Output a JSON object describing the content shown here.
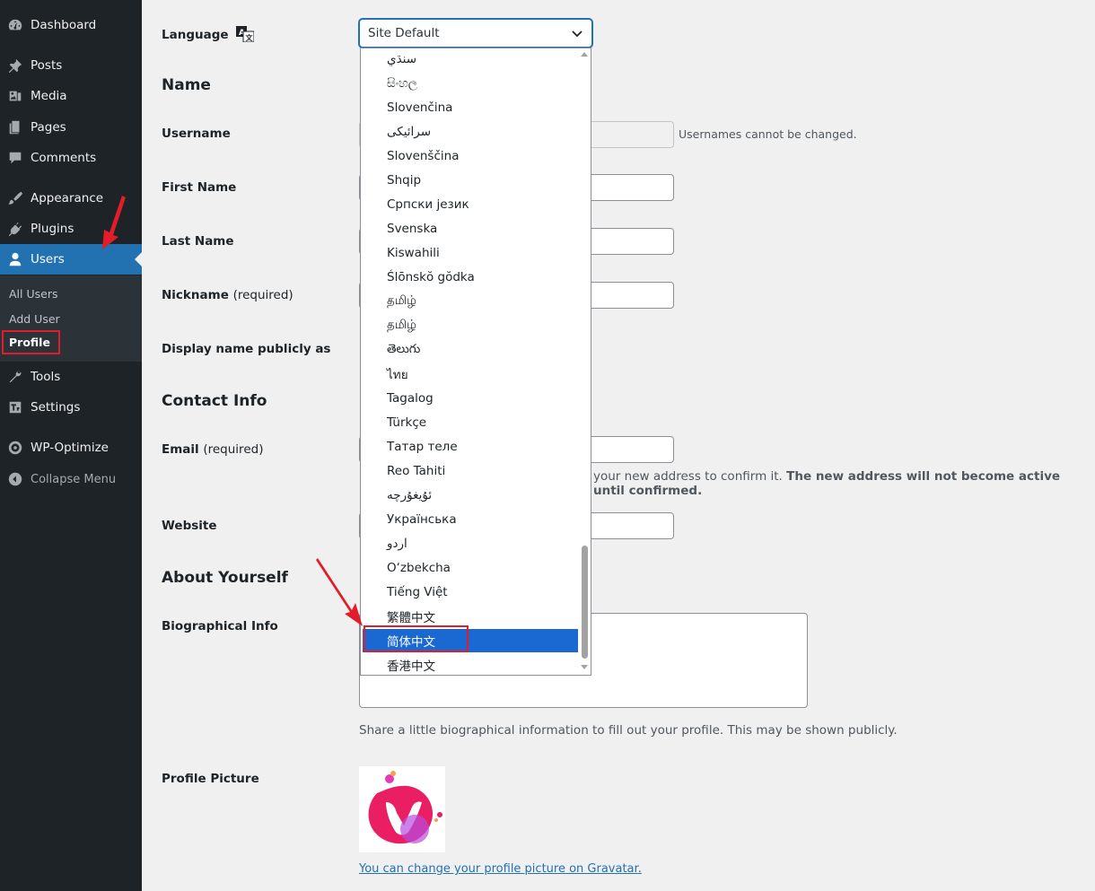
{
  "sidebar": {
    "items": [
      {
        "label": "Dashboard",
        "icon": "dashboard-icon"
      },
      {
        "label": "Posts",
        "icon": "pin-icon"
      },
      {
        "label": "Media",
        "icon": "media-icon"
      },
      {
        "label": "Pages",
        "icon": "pages-icon"
      },
      {
        "label": "Comments",
        "icon": "comment-icon"
      },
      {
        "label": "Appearance",
        "icon": "paintbrush-icon"
      },
      {
        "label": "Plugins",
        "icon": "plugin-icon"
      },
      {
        "label": "Users",
        "icon": "user-icon"
      },
      {
        "label": "Tools",
        "icon": "wrench-icon"
      },
      {
        "label": "Settings",
        "icon": "settings-icon"
      },
      {
        "label": "WP-Optimize",
        "icon": "wp-optimize-icon"
      },
      {
        "label": "Collapse Menu",
        "icon": "collapse-icon"
      }
    ],
    "submenu": [
      {
        "label": "All Users"
      },
      {
        "label": "Add User"
      },
      {
        "label": "Profile"
      }
    ],
    "colors": {
      "bg": "#1d2327",
      "current": "#2271b1",
      "submenu_bg": "#2c3338"
    }
  },
  "form": {
    "language_label": "Language",
    "language_value": "Site Default",
    "name_section": "Name",
    "username_label": "Username",
    "username_desc": "Usernames cannot be changed.",
    "first_name_label": "First Name",
    "last_name_label": "Last Name",
    "nickname_label": "Nickname",
    "required_text": "(required)",
    "display_name_label": "Display name publicly as",
    "contact_section": "Contact Info",
    "email_label": "Email",
    "email_desc_prefix": "your new address to confirm it. ",
    "email_desc_bold": "The new address will not become active until confirmed.",
    "website_label": "Website",
    "about_section": "About Yourself",
    "bio_label": "Biographical Info",
    "bio_desc": "Share a little biographical information to fill out your profile. This may be shown publicly.",
    "profile_picture_label": "Profile Picture",
    "gravatar_link": "You can change your profile picture on Gravatar",
    "gravatar_suffix": "."
  },
  "language_options": [
    "سنڌي",
    "සිංහල",
    "Slovenčina",
    "سرائیکی",
    "Slovenščina",
    "Shqip",
    "Српски језик",
    "Svenska",
    "Kiswahili",
    "Ślōnskŏ gŏdka",
    "தமிழ்",
    "தமிழ்",
    "తెలుగు",
    "ไทย",
    "Tagalog",
    "Türkçe",
    "Татар теле",
    "Reo Tahiti",
    "ئۇيغۇرچە",
    "Українська",
    "اردو",
    "O‘zbekcha",
    "Tiếng Việt",
    "繁體中文",
    "简体中文",
    "香港中文"
  ],
  "selected_option": "简体中文",
  "accent_color": "#2271b1",
  "highlight_color": "#e11d2a"
}
